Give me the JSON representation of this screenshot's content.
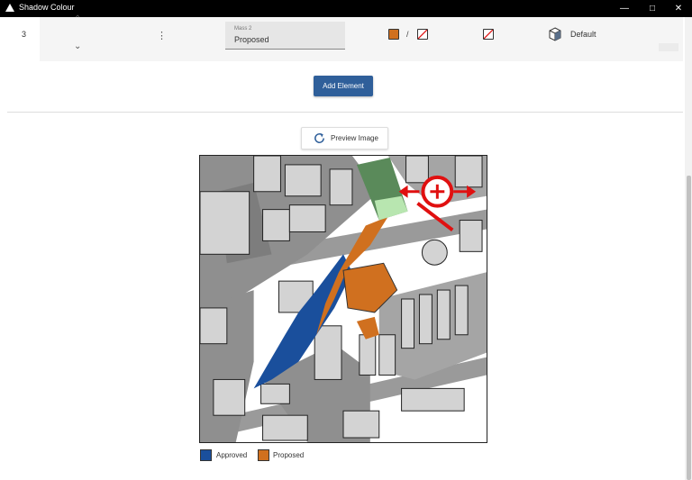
{
  "window": {
    "title": "Shadow Colour",
    "controls": [
      "minimize-icon",
      "maximize-icon",
      "close-icon"
    ]
  },
  "row": {
    "index": "3",
    "mass_label": "Mass 2",
    "mass_value": "Proposed",
    "color_swatch": "#d0701f",
    "separator": "/",
    "view_label": "Default"
  },
  "buttons": {
    "add_element": "Add Element",
    "preview_image": "Preview Image"
  },
  "legend": [
    {
      "label": "Approved",
      "color": "#1a4f9c"
    },
    {
      "label": "Proposed",
      "color": "#d0701f"
    }
  ],
  "colors": {
    "accent": "#2f5f9a",
    "approved": "#1a4f9c",
    "proposed": "#d0701f",
    "zoom": "#e01010"
  }
}
